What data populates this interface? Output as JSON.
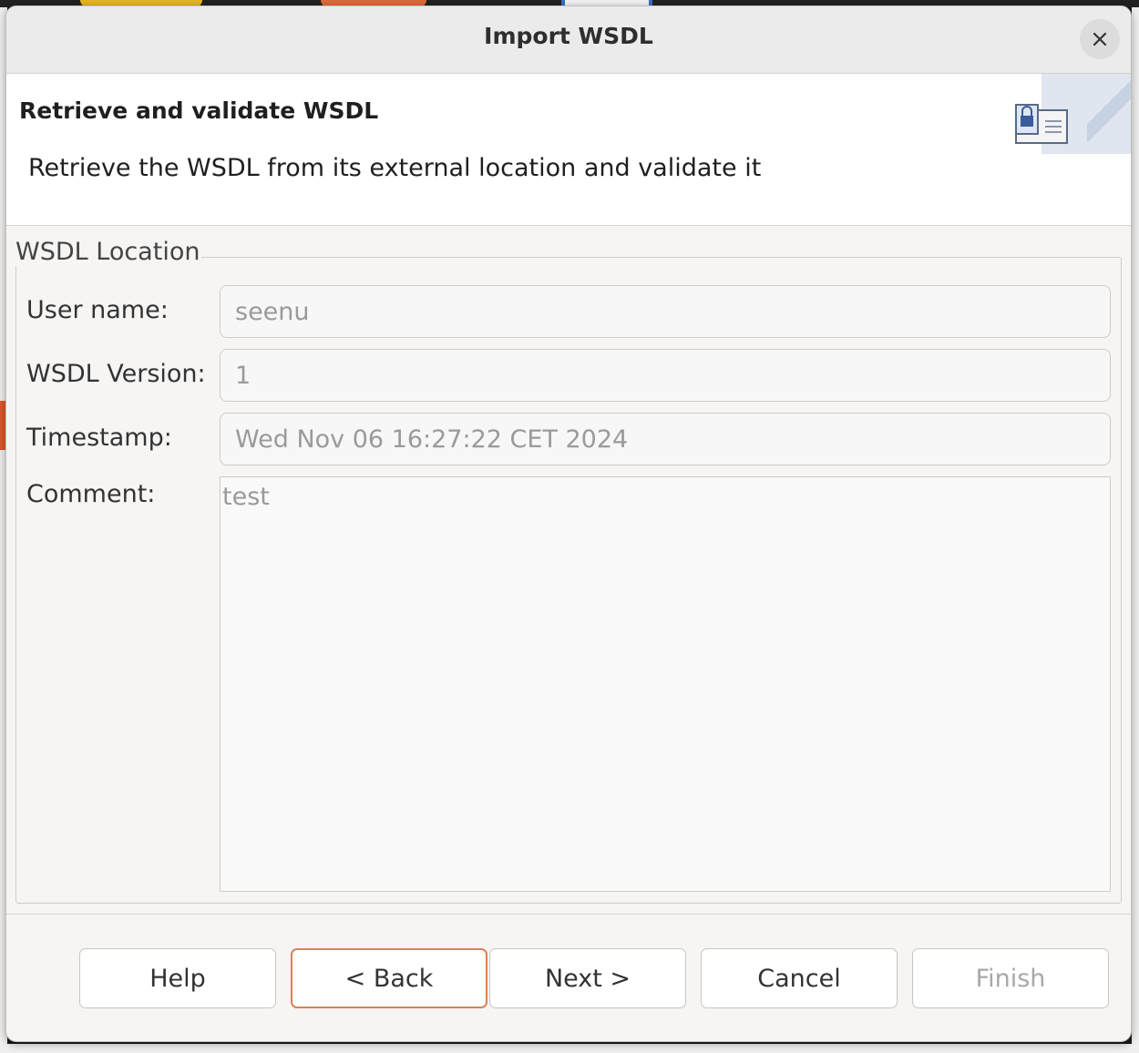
{
  "dialog": {
    "title": "Import WSDL",
    "close_icon": "close-icon"
  },
  "banner": {
    "title": "Retrieve and validate WSDL",
    "description": "Retrieve the WSDL from its external location and validate it",
    "icon": "wizard-document-icon"
  },
  "group": {
    "legend": "WSDL Location",
    "fields": {
      "user_name": {
        "label": "User name:",
        "value": "seenu"
      },
      "wsdl_version": {
        "label": "WSDL Version:",
        "value": "1"
      },
      "timestamp": {
        "label": "Timestamp:",
        "value": "Wed Nov 06 16:27:22 CET 2024"
      },
      "comment": {
        "label": "Comment:",
        "value": "test"
      }
    }
  },
  "buttons": {
    "help": "Help",
    "back": "< Back",
    "next": "Next >",
    "cancel": "Cancel",
    "finish": "Finish"
  },
  "colors": {
    "focus_border": "#d98158",
    "disabled_text": "#a8a8a8"
  }
}
